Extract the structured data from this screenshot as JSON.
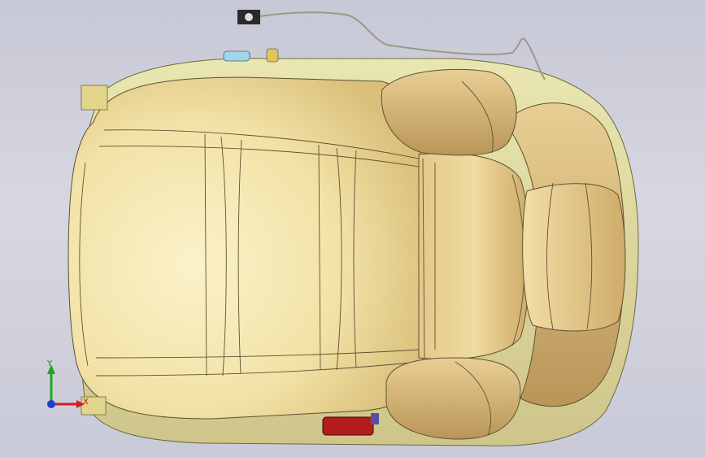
{
  "viewer": {
    "view": "top",
    "model": "car seat",
    "background_colors": [
      "#c7c8d6",
      "#d7d7e0"
    ],
    "model_color": "#f2e4a8"
  },
  "triad": {
    "y_label": "Y",
    "x_label": "X",
    "x_color": "#d21e1e",
    "y_color": "#1fa81f",
    "z_color": "#1f3fd0"
  },
  "parts": [
    {
      "name": "seat-cushion"
    },
    {
      "name": "seat-backrest"
    },
    {
      "name": "headrest"
    },
    {
      "name": "top-side-bolster"
    },
    {
      "name": "bottom-side-bolster"
    },
    {
      "name": "wire-harness"
    },
    {
      "name": "connector-plug"
    },
    {
      "name": "red-connector"
    },
    {
      "name": "seat-frame-rail"
    }
  ]
}
